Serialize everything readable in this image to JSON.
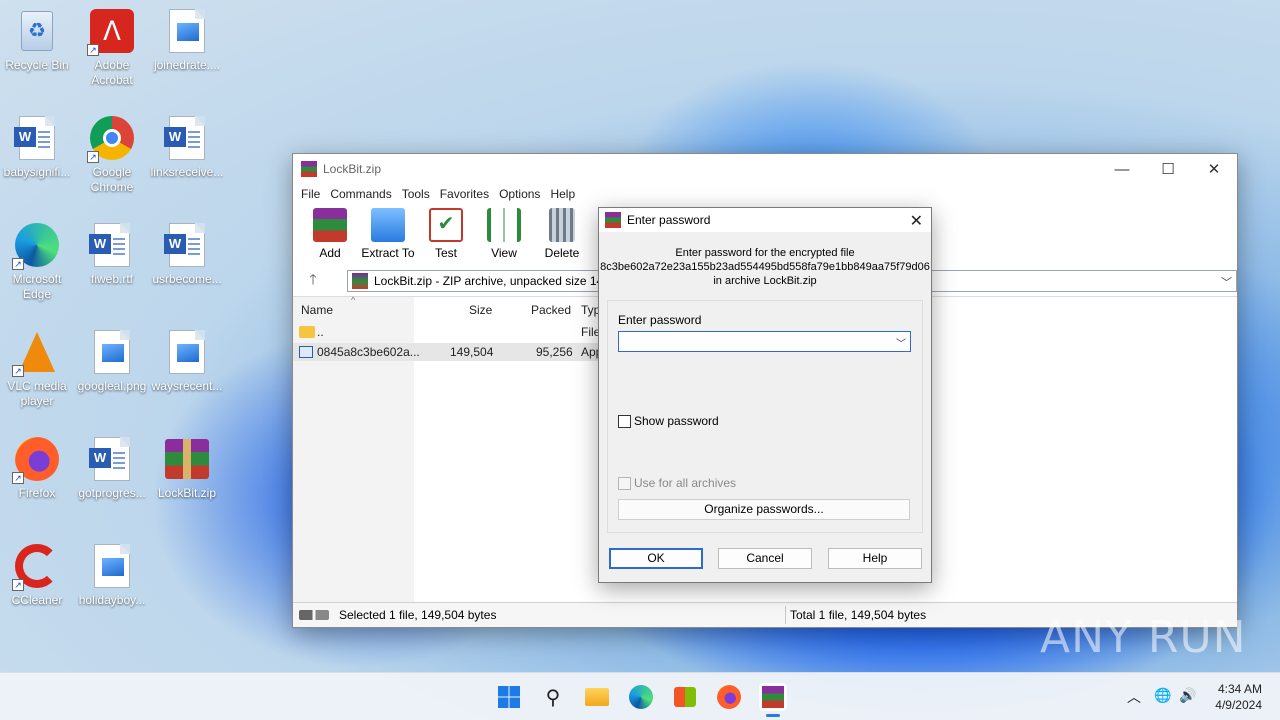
{
  "desktop": {
    "icons": [
      {
        "label": "Recycle Bin"
      },
      {
        "label": "Adobe Acrobat"
      },
      {
        "label": "joinedrate...."
      },
      {
        "label": "babysignifi..."
      },
      {
        "label": "Google Chrome"
      },
      {
        "label": "linksreceive..."
      },
      {
        "label": "Microsoft Edge"
      },
      {
        "label": "fiweb.rtf"
      },
      {
        "label": "usrbecome..."
      },
      {
        "label": "VLC media player"
      },
      {
        "label": "googleal.png"
      },
      {
        "label": "waysrecent..."
      },
      {
        "label": "Firefox"
      },
      {
        "label": "gotprogres..."
      },
      {
        "label": "LockBit.zip"
      },
      {
        "label": "CCleaner"
      },
      {
        "label": "holidayboy..."
      }
    ]
  },
  "window": {
    "title": "LockBit.zip",
    "menu": [
      "File",
      "Commands",
      "Tools",
      "Favorites",
      "Options",
      "Help"
    ],
    "toolbar": [
      "Add",
      "Extract To",
      "Test",
      "View",
      "Delete"
    ],
    "path": "LockBit.zip - ZIP archive, unpacked size 149",
    "columns": {
      "name": "Name",
      "size": "Size",
      "packed": "Packed",
      "type": "Typ"
    },
    "rows": [
      {
        "name": "..",
        "size": "",
        "packed": "",
        "type": "File"
      },
      {
        "name": "0845a8c3be602a...",
        "size": "149,504",
        "packed": "95,256",
        "type": "App"
      }
    ],
    "status_left": "Selected 1 file, 149,504 bytes",
    "status_right": "Total 1 file, 149,504 bytes"
  },
  "dialog": {
    "title": "Enter password",
    "info_line1": "Enter password for the encrypted file",
    "info_line2": "8c3be602a72e23a155b23ad554495bd558fa79e1bb849aa75f79d06",
    "info_line3": "in archive LockBit.zip",
    "password_label": "Enter password",
    "password_value": "",
    "show_password": "Show password",
    "use_for_all": "Use for all archives",
    "organize": "Organize passwords...",
    "ok": "OK",
    "cancel": "Cancel",
    "help": "Help"
  },
  "taskbar": {
    "time": "4:34 AM",
    "date": "4/9/2024"
  },
  "watermark": "ANY RUN"
}
